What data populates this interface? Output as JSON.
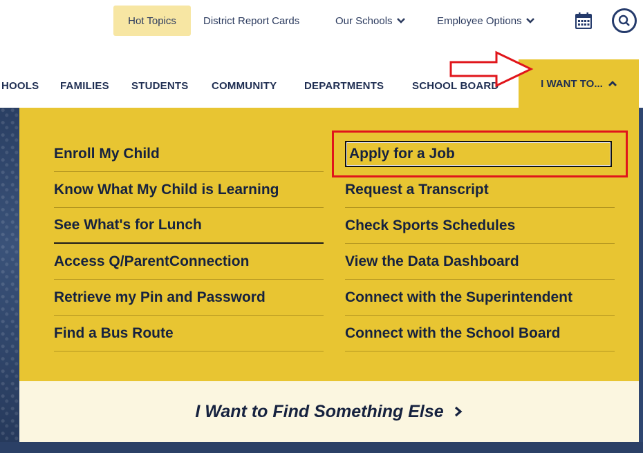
{
  "utility": {
    "hot_topics": "Hot Topics",
    "report_cards": "District Report Cards",
    "our_schools": "Our Schools",
    "employee_options": "Employee Options"
  },
  "nav": {
    "items": [
      "HOOLS",
      "FAMILIES",
      "STUDENTS",
      "COMMUNITY",
      "DEPARTMENTS",
      "SCHOOL BOARD"
    ],
    "active": "I WANT TO..."
  },
  "menu": {
    "left": [
      "Enroll My Child",
      "Know What My Child is Learning",
      "See What's for Lunch",
      "Access Q/ParentConnection",
      "Retrieve my Pin and Password",
      "Find a Bus Route"
    ],
    "right": [
      "Apply for a Job",
      "Request a Transcript",
      "Check Sports Schedules",
      "View the Data Dashboard",
      "Connect with the Superintendent",
      "Connect with the School Board"
    ],
    "find_else": "I Want to Find Something Else"
  },
  "colors": {
    "gold": "#e8c532",
    "navy": "#1f2e52",
    "highlight_red": "#e0151b",
    "cream": "#fbf6e0"
  },
  "icons": {
    "calendar": "calendar-icon",
    "search": "search-icon",
    "chevron": "chevron-down-icon",
    "caret_up": "chevron-up-icon",
    "arrow": "arrow-right-icon"
  }
}
